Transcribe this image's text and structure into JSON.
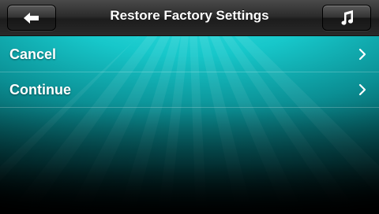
{
  "header": {
    "title": "Restore Factory Settings",
    "back_icon": "back-arrow-icon",
    "music_icon": "music-note-icon"
  },
  "menu": {
    "items": [
      {
        "label": "Cancel",
        "icon": "chevron-right-icon"
      },
      {
        "label": "Continue",
        "icon": "chevron-right-icon"
      }
    ]
  },
  "colors": {
    "accent": "#17c7ca",
    "header_bg": "#2c2c2c",
    "text": "#ffffff"
  }
}
